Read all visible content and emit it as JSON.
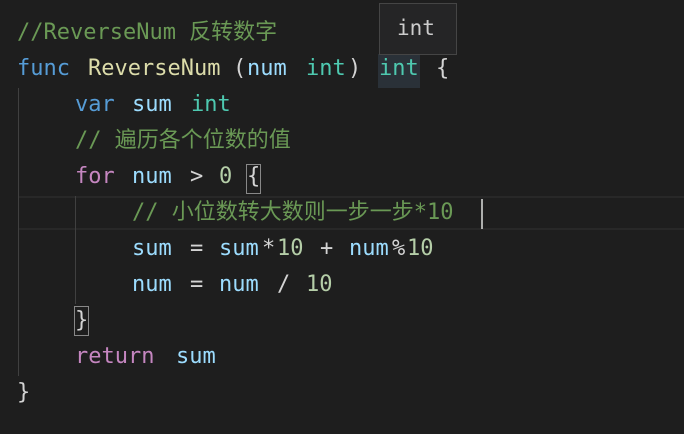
{
  "editor": {
    "lines": {
      "l1": {
        "comment": "//ReverseNum 反转数字"
      },
      "l2": {
        "func_kw": "func",
        "fn_name": "ReverseNum",
        "open_paren": "(",
        "param": "num",
        "param_type": "int",
        "close_paren": ")",
        "return_type": "int",
        "open_brace": "{"
      },
      "l3": {
        "var_kw": "var",
        "var_name": "sum",
        "var_type": "int"
      },
      "l4": {
        "comment": "// 遍历各个位数的值"
      },
      "l5": {
        "for_kw": "for",
        "loop_var": "num",
        "op": ">",
        "zero": "0",
        "open_brace": "{"
      },
      "l6": {
        "comment": "// 小位数转大数则一步一步*10"
      },
      "l7": {
        "lhs": "sum",
        "eq": "=",
        "sum": "sum",
        "mul": "*",
        "ten": "10",
        "plus": "+",
        "num": "num",
        "mod": "%",
        "ten2": "10"
      },
      "l8": {
        "lhs": "num",
        "eq": "=",
        "num": "num",
        "div": "/",
        "ten": "10"
      },
      "l9": {
        "close_brace": "}"
      },
      "l10": {
        "return_kw": "return",
        "ret_val": "sum"
      },
      "l11": {
        "close_brace": "}"
      }
    }
  },
  "hover_tooltip": {
    "text": "int"
  },
  "colors": {
    "background": "#1e1e1e",
    "comment": "#6a9955",
    "keyword": "#569cd6",
    "control": "#c586c0",
    "function": "#dcdcaa",
    "variable": "#9cdcfe",
    "type": "#4ec9b0",
    "number": "#b5cea8"
  }
}
